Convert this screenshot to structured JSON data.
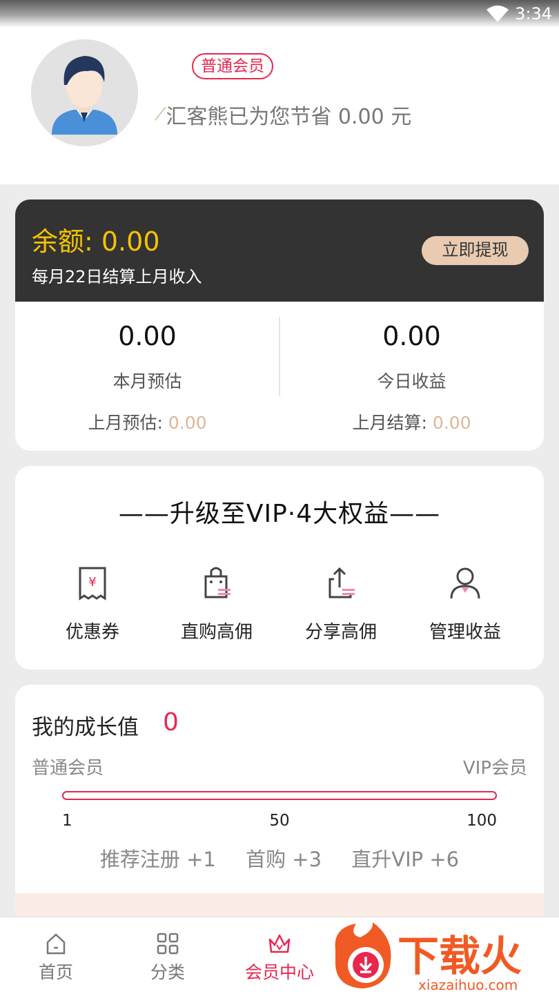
{
  "status_bar": {
    "time": "3:34"
  },
  "profile": {
    "level_badge": "普通会员",
    "savings_text": "汇客熊已为您节省 0.00 元"
  },
  "balance": {
    "amount_text": "余额: 0.00",
    "settle_note": "每月22日结算上月收入",
    "withdraw_label": "立即提现",
    "stats": [
      {
        "value": "0.00",
        "label": "本月预估",
        "sub_label": "上月预估: ",
        "sub_value": "0.00"
      },
      {
        "value": "0.00",
        "label": "今日收益",
        "sub_label": "上月结算: ",
        "sub_value": "0.00"
      }
    ]
  },
  "vip": {
    "title": "——升级至VIP·4大权益——",
    "benefits": [
      {
        "label": "优惠券",
        "icon": "coupon-icon"
      },
      {
        "label": "直购高佣",
        "icon": "shopping-bag-icon"
      },
      {
        "label": "分享高佣",
        "icon": "share-icon"
      },
      {
        "label": "管理收益",
        "icon": "user-manage-icon"
      }
    ]
  },
  "growth": {
    "title": "我的成长值",
    "value": "0",
    "level_left": "普通会员",
    "level_right": "VIP会员",
    "progress_fraction": 0,
    "ticks": [
      "1",
      "50",
      "100"
    ],
    "rules": [
      "推荐注册 +1",
      "首购 +3",
      "直升VIP +6"
    ]
  },
  "nav": {
    "items": [
      {
        "label": "首页",
        "icon": "home-icon",
        "active": false
      },
      {
        "label": "分类",
        "icon": "grid-icon",
        "active": false
      },
      {
        "label": "会员中心",
        "icon": "crown-icon",
        "active": true
      }
    ]
  },
  "watermark": {
    "brand": "下载火",
    "url": "xiazaihuo.com"
  },
  "colors": {
    "accent": "#e8264e",
    "gold": "#f5c400",
    "dark_card": "#333333",
    "tan": "#e9cbb2"
  }
}
